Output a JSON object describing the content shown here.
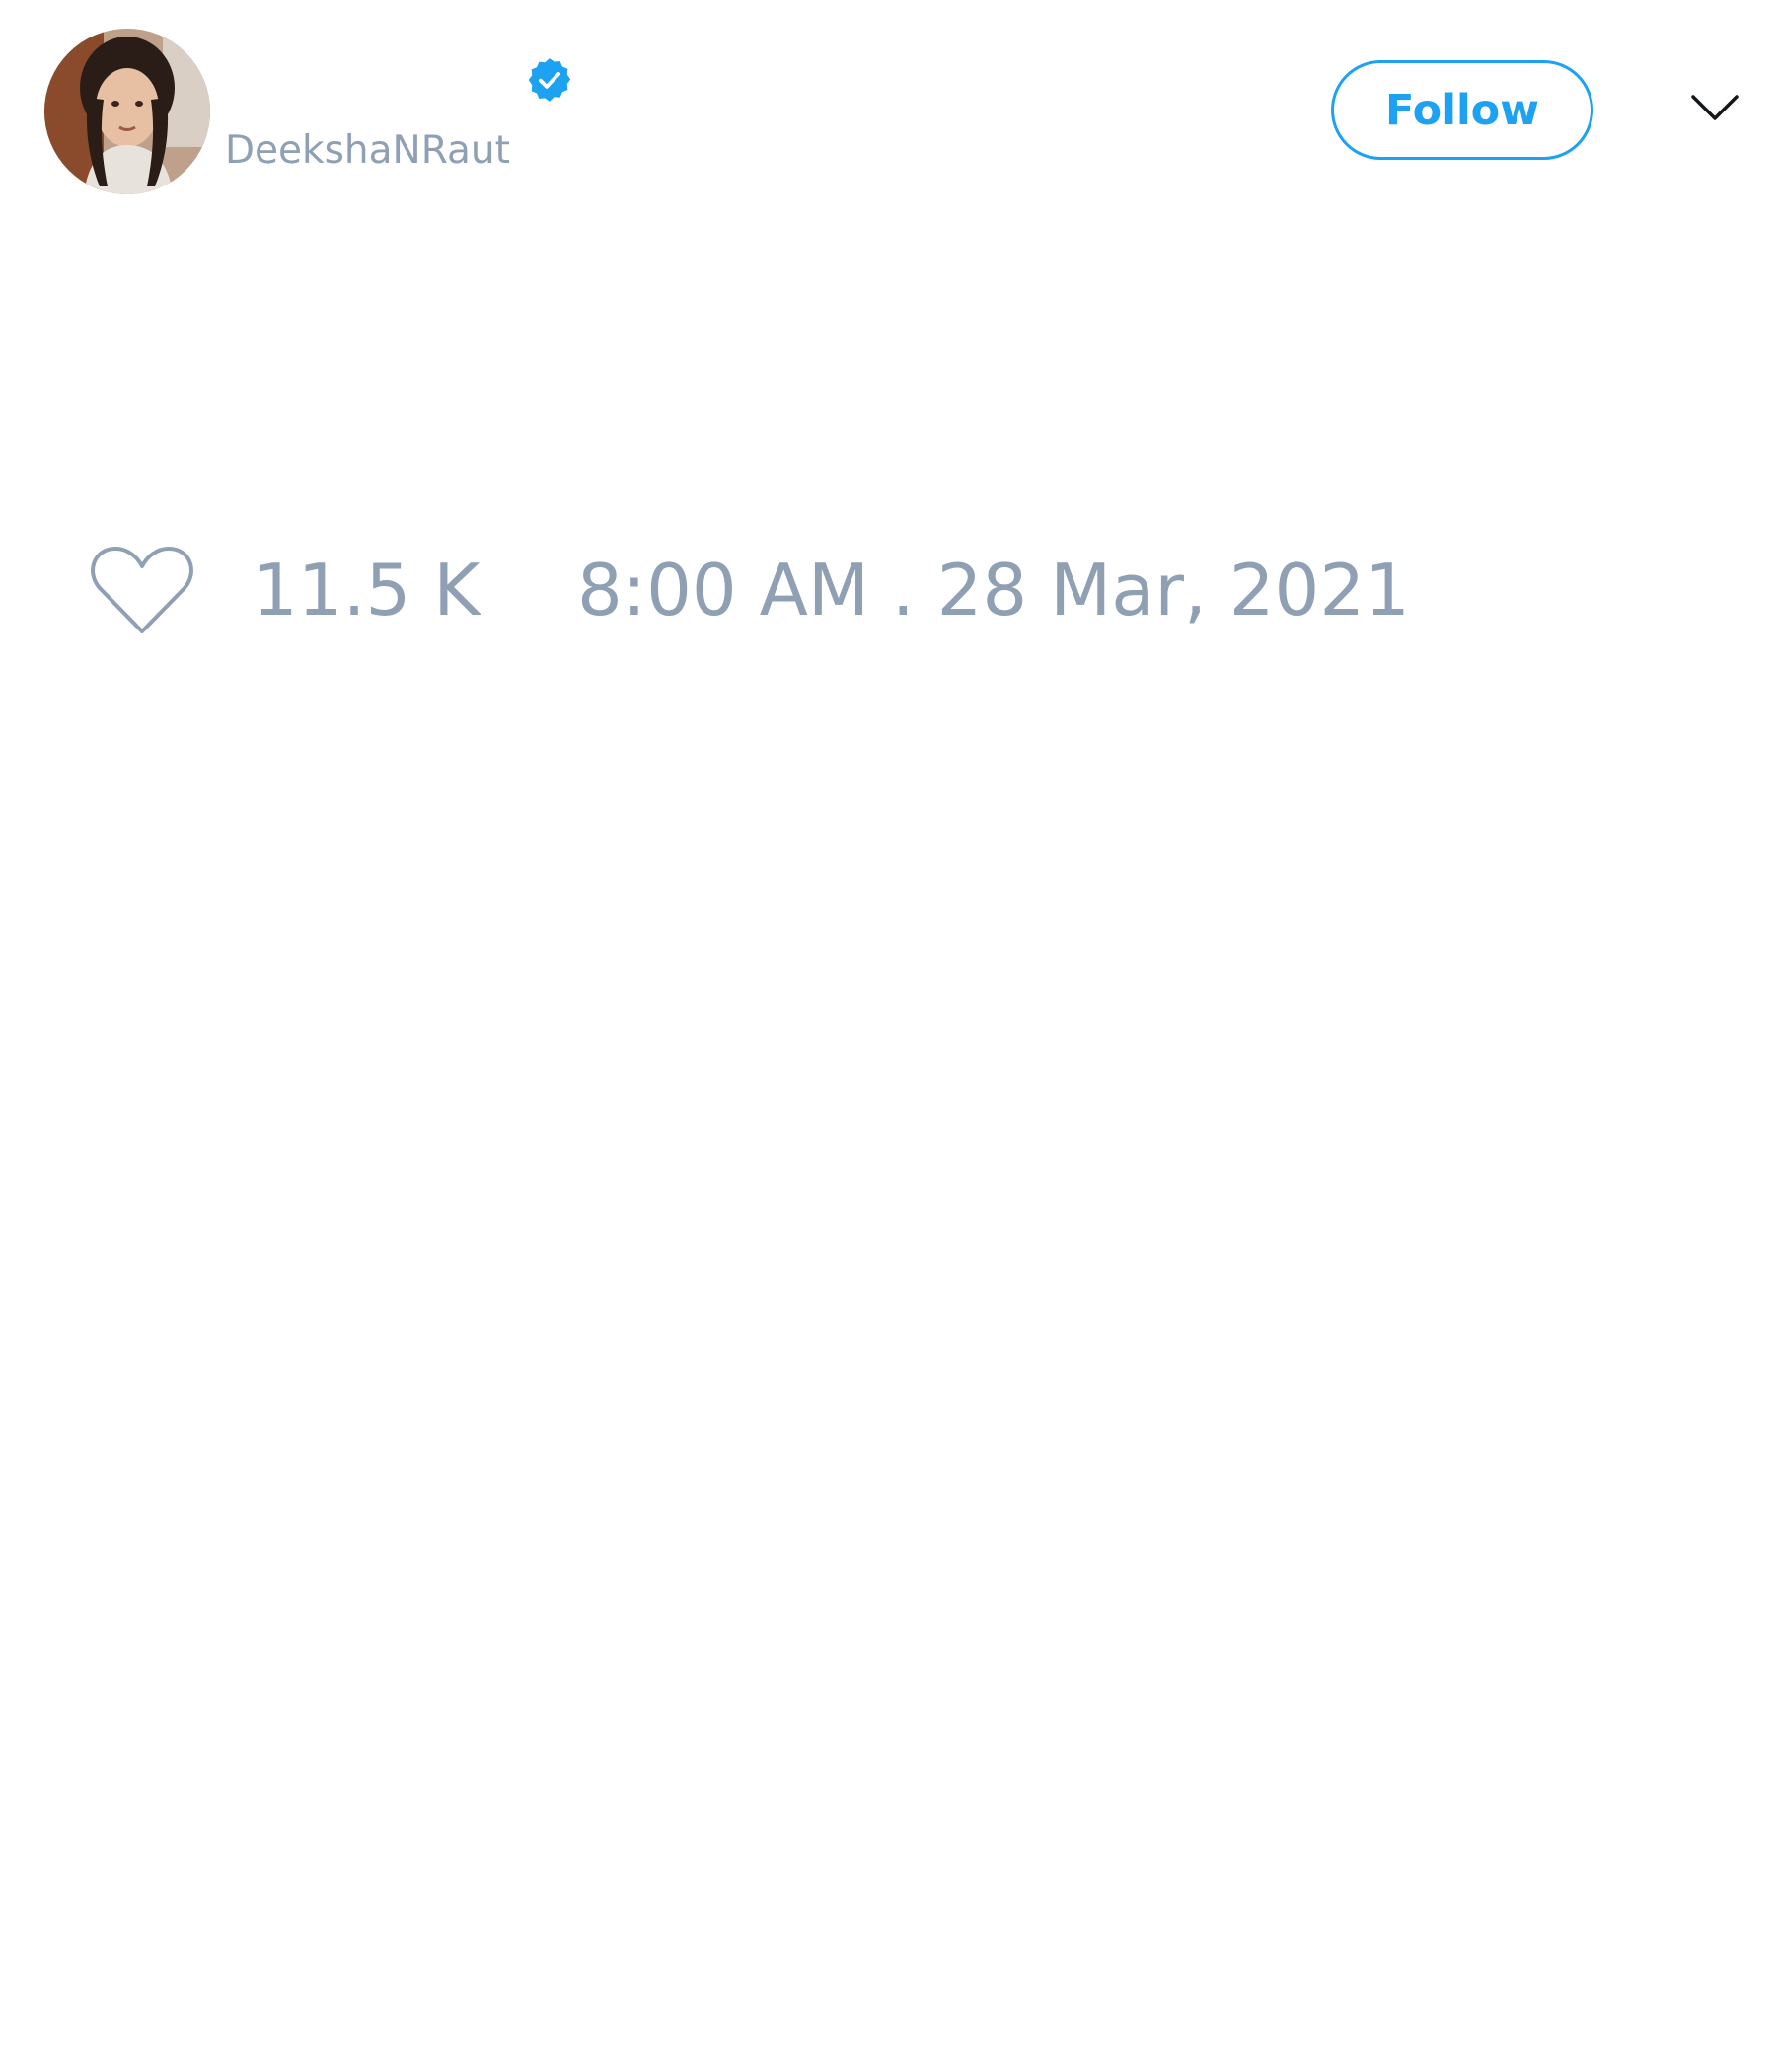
{
  "tweet": {
    "author": {
      "handle": "DeekshaNRaut",
      "verified": true,
      "avatar_icon": "profile-photo"
    },
    "follow_label": "Follow",
    "menu_icon": "chevron-down-icon",
    "likes": {
      "icon": "heart-icon",
      "count": "11.5 K"
    },
    "timestamp": "8:00 AM . 28 Mar, 2021"
  },
  "colors": {
    "accent": "#1da1f2",
    "muted_text": "#8f9fb4",
    "background": "#ffffff"
  }
}
